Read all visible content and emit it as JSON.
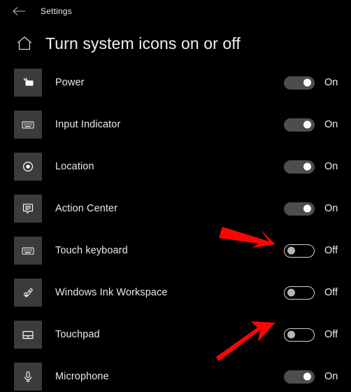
{
  "titlebar": {
    "back_icon": "back-arrow-icon",
    "app_title": "Settings"
  },
  "header": {
    "home_icon": "home-icon",
    "page_title": "Turn system icons on or off"
  },
  "colors": {
    "background": "#000000",
    "tile": "#3b3b3b",
    "text": "#e9e9e9",
    "toggle_on_track": "#4d4d4d",
    "toggle_off_border": "#d2d2d2",
    "toggle_off_knob": "#b5b5b5",
    "annotation_arrow": "#fb0606"
  },
  "list": {
    "items": [
      {
        "icon": "power-battery-icon",
        "label": "Power",
        "state": "On"
      },
      {
        "icon": "keyboard-icon",
        "label": "Input Indicator",
        "state": "On"
      },
      {
        "icon": "location-icon",
        "label": "Location",
        "state": "On"
      },
      {
        "icon": "action-center-icon",
        "label": "Action Center",
        "state": "On"
      },
      {
        "icon": "touch-keyboard-icon",
        "label": "Touch keyboard",
        "state": "Off"
      },
      {
        "icon": "pen-ink-icon",
        "label": "Windows Ink Workspace",
        "state": "Off"
      },
      {
        "icon": "touchpad-icon",
        "label": "Touchpad",
        "state": "Off"
      },
      {
        "icon": "microphone-icon",
        "label": "Microphone",
        "state": "On"
      }
    ]
  },
  "annotations": [
    {
      "name": "arrow-touch-keyboard",
      "target": "Touch keyboard toggle"
    },
    {
      "name": "arrow-touchpad",
      "target": "Touchpad toggle"
    }
  ]
}
